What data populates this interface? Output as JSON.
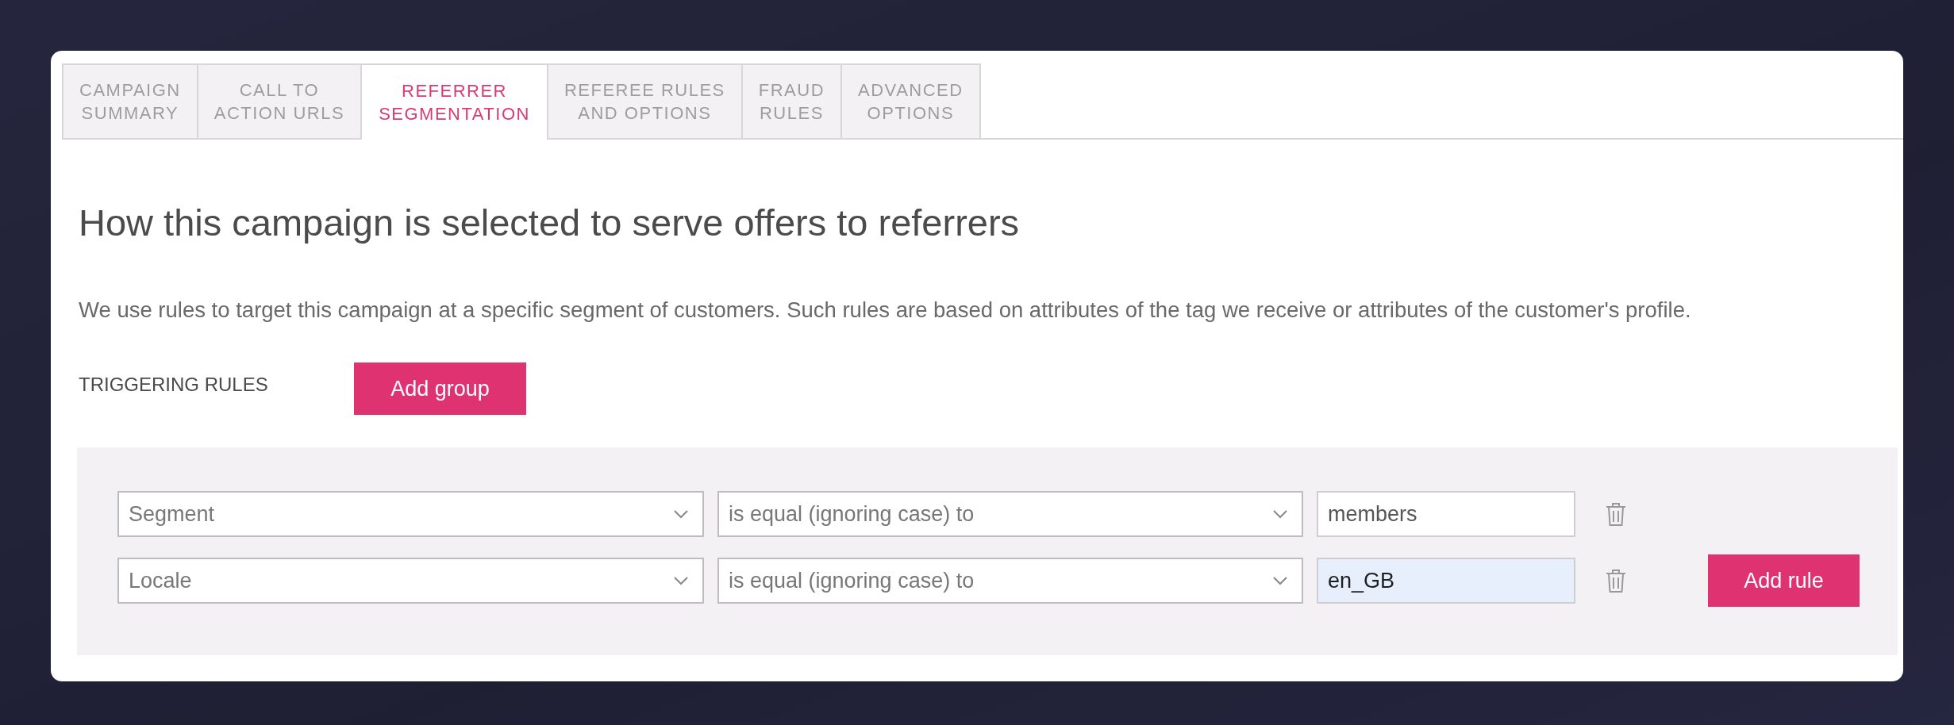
{
  "tabs": [
    {
      "label": "CAMPAIGN\nSUMMARY",
      "selected": false
    },
    {
      "label": "CALL TO\nACTION URLS",
      "selected": false
    },
    {
      "label": "REFERRER\nSEGMENTATION",
      "selected": true
    },
    {
      "label": "REFEREE RULES\nAND OPTIONS",
      "selected": false
    },
    {
      "label": "FRAUD\nRULES",
      "selected": false
    },
    {
      "label": "ADVANCED\nOPTIONS",
      "selected": false
    }
  ],
  "heading": "How this campaign is selected to serve offers to referrers",
  "description": "We use rules to target this campaign at a specific segment of customers. Such rules are based on attributes of the tag we receive or attributes of the customer's profile.",
  "triggering_rules": {
    "label": "TRIGGERING RULES",
    "add_group_button": "Add group",
    "rules": [
      {
        "attribute": "Segment",
        "operator": "is equal (ignoring case) to",
        "value": "members",
        "focused": false
      },
      {
        "attribute": "Locale",
        "operator": "is equal (ignoring case) to",
        "value": "en_GB",
        "focused": true
      }
    ],
    "add_rule_button": "Add rule"
  }
}
